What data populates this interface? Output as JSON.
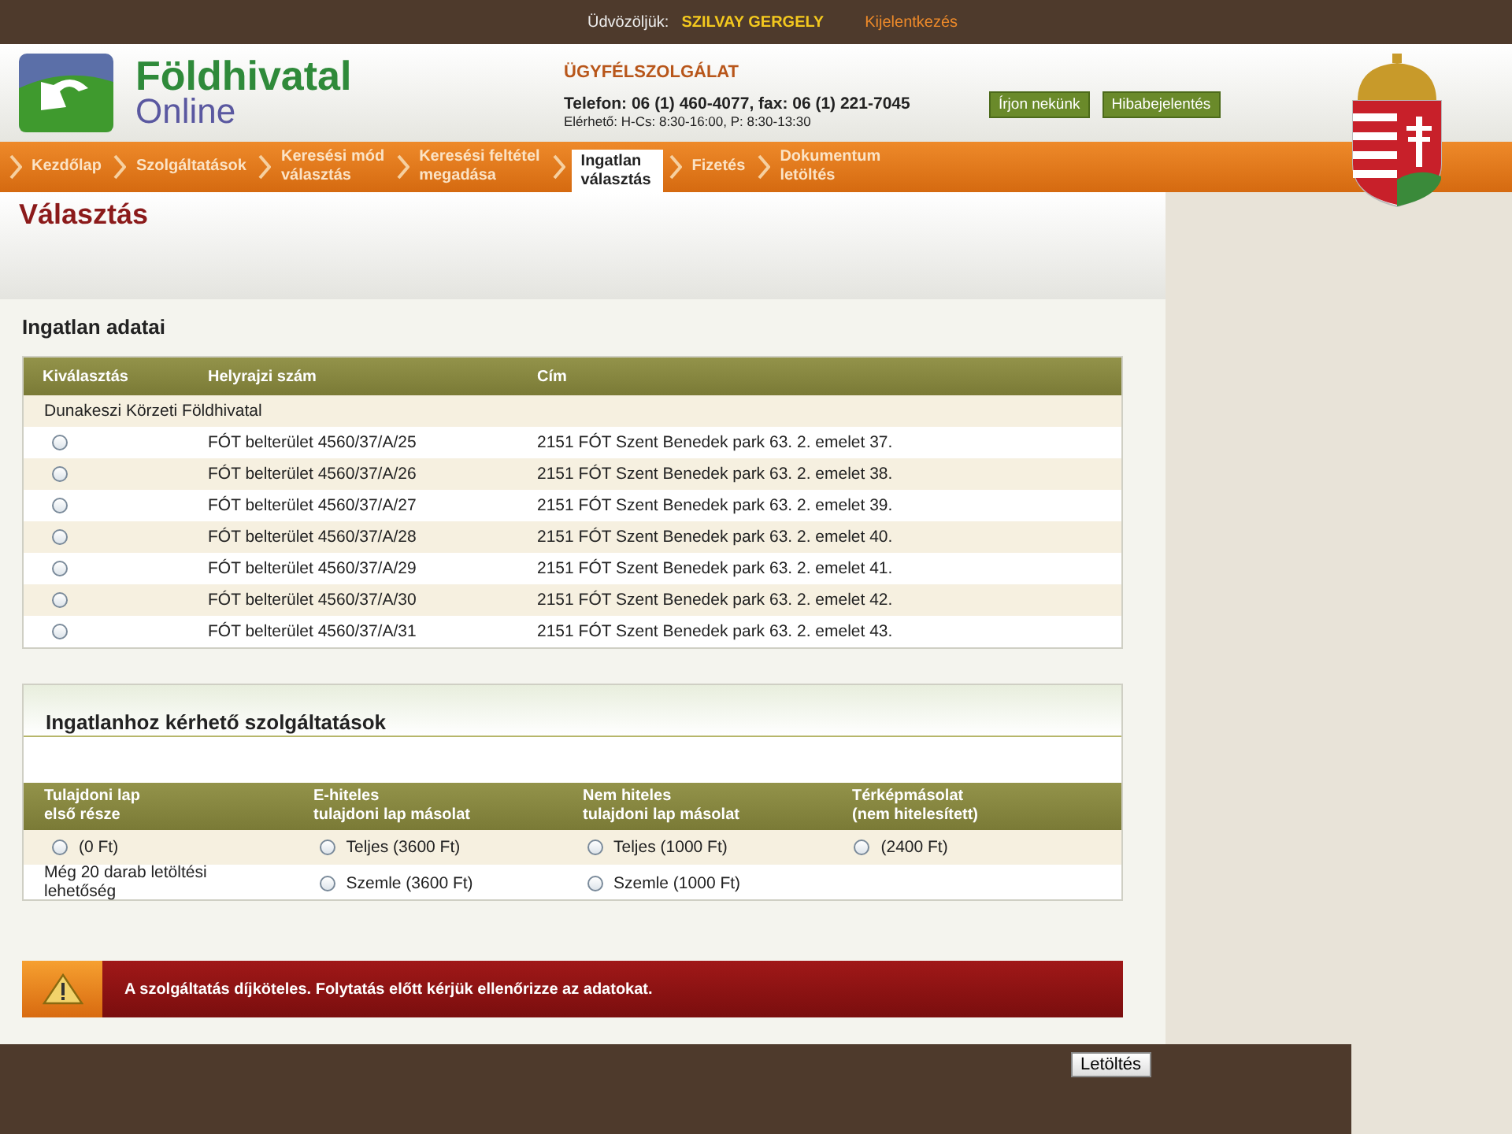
{
  "top_bar": {
    "greeting": "Üdvözöljük:",
    "user": "SZILVAY GERGELY",
    "logout": "Kijelentkezés"
  },
  "header": {
    "logo_title": "Földhivatal",
    "logo_subtitle": "Online",
    "service_title": "ÜGYFÉLSZOLGÁLAT",
    "phone": "Telefon: 06 (1) 460-4077, fax: 06 (1) 221-7045",
    "hours": "Elérhető: H-Cs: 8:30-16:00, P: 8:30-13:30",
    "buttons": [
      "Írjon nekünk",
      "Hibabejelentés"
    ]
  },
  "nav": [
    {
      "label": "Kezdőlap",
      "selected": false
    },
    {
      "label": "Szolgáltatások",
      "selected": false
    },
    {
      "label": "Keresési mód\nválasztás",
      "selected": false
    },
    {
      "label": "Keresési feltétel\nmegadása",
      "selected": false
    },
    {
      "label": "Ingatlan\nválasztás",
      "selected": true
    },
    {
      "label": "Fizetés",
      "selected": false
    },
    {
      "label": "Dokumentum\nletöltés",
      "selected": false
    }
  ],
  "page_title": "Választás",
  "property_section": {
    "title": "Ingatlan adatai",
    "columns": [
      "Kiválasztás",
      "Helyrajzi szám",
      "Cím"
    ],
    "group": "Dunakeszi Körzeti Földhivatal",
    "rows": [
      {
        "selected": false,
        "parcel": "FÓT belterület 4560/37/A/25",
        "address": "2151 FÓT Szent Benedek park 63. 2. emelet 37."
      },
      {
        "selected": false,
        "parcel": "FÓT belterület 4560/37/A/26",
        "address": "2151 FÓT Szent Benedek park 63. 2. emelet 38."
      },
      {
        "selected": false,
        "parcel": "FÓT belterület 4560/37/A/27",
        "address": "2151 FÓT Szent Benedek park 63. 2. emelet 39."
      },
      {
        "selected": false,
        "parcel": "FÓT belterület 4560/37/A/28",
        "address": "2151 FÓT Szent Benedek park 63. 2. emelet 40."
      },
      {
        "selected": false,
        "parcel": "FÓT belterület 4560/37/A/29",
        "address": "2151 FÓT Szent Benedek park 63. 2. emelet 41."
      },
      {
        "selected": false,
        "parcel": "FÓT belterület 4560/37/A/30",
        "address": "2151 FÓT Szent Benedek park 63. 2. emelet 42."
      },
      {
        "selected": false,
        "parcel": "FÓT belterület 4560/37/A/31",
        "address": "2151 FÓT Szent Benedek park 63. 2. emelet 43."
      }
    ]
  },
  "services_section": {
    "title": "Ingatlanhoz kérhető szolgáltatások",
    "columns": [
      "Tulajdoni lap\nelső része",
      "E-hiteles\ntulajdoni lap másolat",
      "Nem hiteles\ntulajdoni lap másolat",
      "Térképmásolat\n(nem hitelesített)"
    ],
    "rows": [
      {
        "cells": [
          {
            "kind": "option",
            "label": "(0 Ft)",
            "selected": false
          },
          {
            "kind": "option",
            "label": "Teljes (3600 Ft)",
            "selected": false
          },
          {
            "kind": "option",
            "label": "Teljes (1000 Ft)",
            "selected": false
          },
          {
            "kind": "option",
            "label": "(2400 Ft)",
            "selected": false
          }
        ]
      },
      {
        "cells": [
          {
            "kind": "text",
            "label": "Még 20 darab letöltési\nlehetőség"
          },
          {
            "kind": "option",
            "label": "Szemle (3600 Ft)",
            "selected": false
          },
          {
            "kind": "option",
            "label": "Szemle (1000 Ft)",
            "selected": false
          }
        ]
      }
    ]
  },
  "warning": "A szolgáltatás díjköteles. Folytatás előtt kérjük ellenőrizze az adatokat.",
  "footer": {
    "button": "Letöltés"
  }
}
